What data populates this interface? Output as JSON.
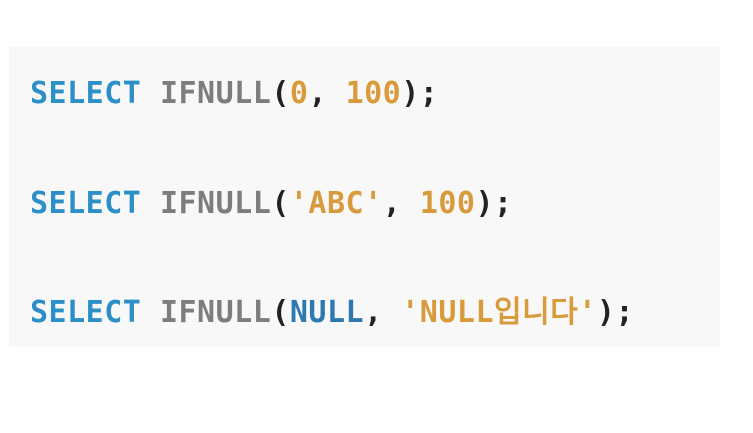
{
  "code": {
    "lines": [
      {
        "keyword": "SELECT",
        "function": "IFNULL",
        "open_paren": "(",
        "arg1": "0",
        "comma": ", ",
        "arg2": "100",
        "close": ");"
      },
      {
        "keyword": "SELECT",
        "function": "IFNULL",
        "open_paren": "(",
        "arg1": "'ABC'",
        "comma": ", ",
        "arg2": "100",
        "close": ");"
      },
      {
        "keyword": "SELECT",
        "function": "IFNULL",
        "open_paren": "(",
        "arg1": "NULL",
        "comma": ", ",
        "arg2": "'NULL입니다'",
        "close": ");"
      }
    ]
  },
  "colors": {
    "keyword": "#2d8fc8",
    "function": "#7d7d7d",
    "literal": "#d99a3c",
    "null_keyword": "#2d79b0",
    "punctuation": "#222222",
    "code_background": "#f8f8f8"
  }
}
